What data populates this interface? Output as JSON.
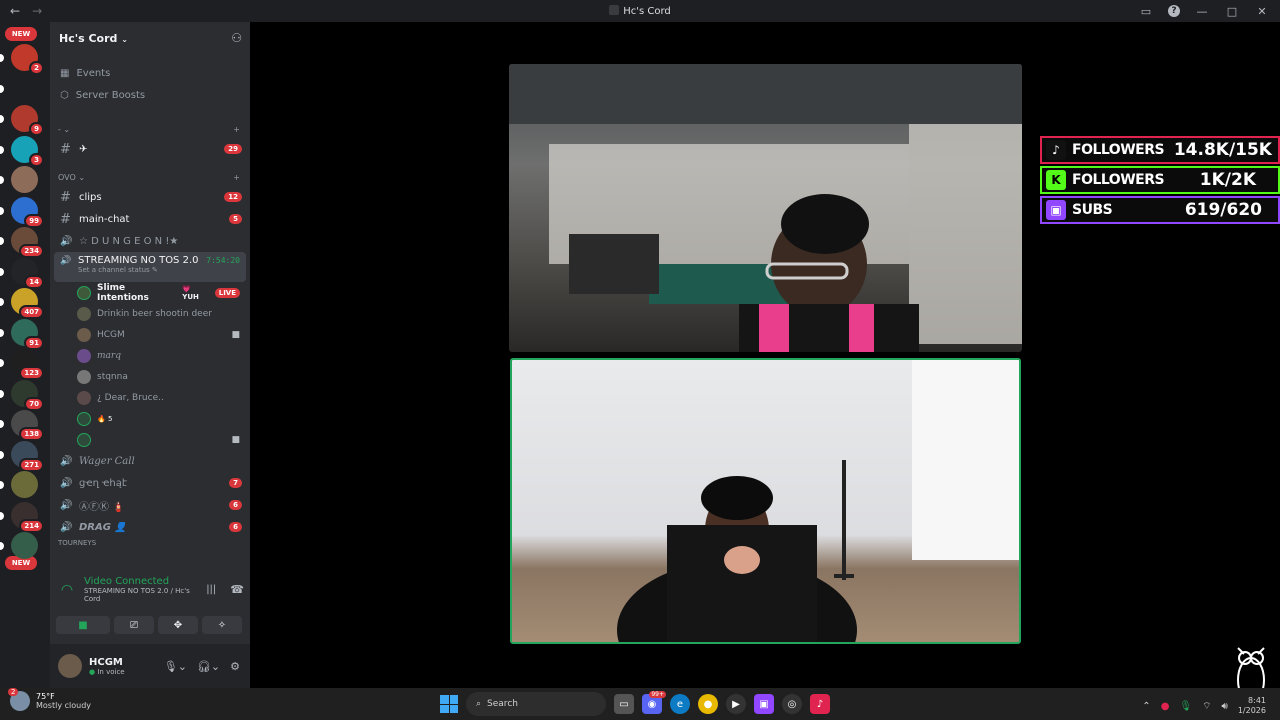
{
  "window": {
    "title": "Hc's Cord",
    "nav_back": "←",
    "nav_forward": "→"
  },
  "rail": {
    "new_top": "NEW",
    "new_bottom": "NEW",
    "servers": [
      {
        "color": "#c0392b",
        "badge": "2"
      },
      {
        "color": "#1e1f22",
        "badge": ""
      },
      {
        "color": "#b03a2e",
        "badge": "9"
      },
      {
        "color": "#17a2b8",
        "badge": "3"
      },
      {
        "color": "#8e6c5a",
        "badge": ""
      },
      {
        "color": "#2c6fd1",
        "badge": "99"
      },
      {
        "color": "#6a4b3a",
        "badge": "234"
      },
      {
        "color": "#222428",
        "badge": "14"
      },
      {
        "color": "#c9a227",
        "badge": "407"
      },
      {
        "color": "#2f6b5a",
        "badge": "91"
      },
      {
        "color": "#1f1f1f",
        "badge": "123"
      },
      {
        "color": "#2e3a2e",
        "badge": "70"
      },
      {
        "color": "#4a4a4a",
        "badge": "138"
      },
      {
        "color": "#3b4a5a",
        "badge": "271"
      },
      {
        "color": "#6b6b3a",
        "badge": ""
      },
      {
        "color": "#3a2f2f",
        "badge": "214"
      },
      {
        "color": "#355e4a",
        "badge": ""
      }
    ]
  },
  "sidebar": {
    "server_name": "Hc's Cord",
    "menu": [
      {
        "label": "Events"
      },
      {
        "label": "Server Boosts"
      }
    ],
    "categories": [
      {
        "label": "-"
      },
      {
        "label": "OVO"
      }
    ],
    "channels": {
      "plane": {
        "label": "✈",
        "badge": "29"
      },
      "clips": {
        "label": "clips",
        "badge": "12"
      },
      "main_chat": {
        "label": "main-chat",
        "badge": "5"
      },
      "dungeon": {
        "label": "☆ D U N G E O N !★"
      },
      "streaming": {
        "label": "STREAMING NO TOS 2.0",
        "timer": "7:54:20",
        "status": "Set a channel status"
      },
      "wager": {
        "label": "Wager Call"
      },
      "gen_chat": {
        "label": "ցҽղ ҽհąէ",
        "badge": "7"
      },
      "afk": {
        "label": "ⒶⒻⓀ 🧯",
        "badge": "6"
      },
      "drag": {
        "label": "DRAG 👤",
        "badge": "6"
      },
      "cut_label": "TOURNEYS"
    },
    "members": [
      {
        "name": "Slime Intentions",
        "tag": "💗 YUH",
        "live": "LIVE"
      },
      {
        "name": "Drinkin beer shootin deer"
      },
      {
        "name": "HCGM"
      },
      {
        "name": "marq"
      },
      {
        "name": "stqnna"
      },
      {
        "name": "¿ Dear, Bruce.."
      },
      {
        "name": "",
        "reaction": "🔥 5"
      },
      {
        "name": ""
      }
    ],
    "voice_panel": {
      "title": "Video Connected",
      "subtitle": "STREAMING NO TOS 2.0 / Hc's Cord"
    },
    "user": {
      "name": "HCGM",
      "status": "In voice"
    }
  },
  "overlay": {
    "rows": [
      {
        "label": "FOLLOWERS",
        "value": "14.8K/15K",
        "platform": "tiktok"
      },
      {
        "label": "FOLLOWERS",
        "value": "1K/2K",
        "platform": "kick"
      },
      {
        "label": "SUBS",
        "value": "619/620",
        "platform": "twitch"
      }
    ]
  },
  "taskbar": {
    "weather_temp": "75°F",
    "weather_desc": "Mostly cloudy",
    "weather_badge": "2",
    "search_placeholder": "Search",
    "discord_badge": "99+",
    "clock_time": "8:41",
    "clock_date": "1/2026"
  },
  "colors": {
    "accent_green": "#23a55a",
    "badge_red": "#da373c",
    "tiktok": "#e0244f",
    "kick": "#53fc18",
    "twitch": "#9146ff"
  }
}
